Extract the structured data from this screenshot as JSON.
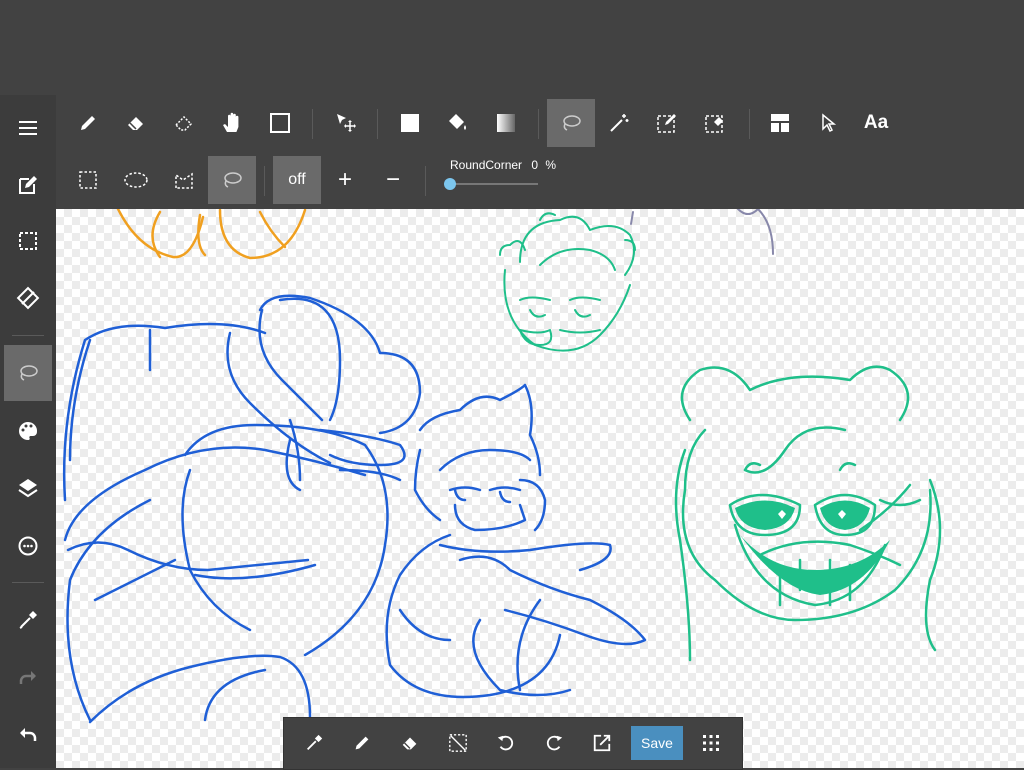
{
  "toolbar": {
    "tools": [
      "pen-icon",
      "eraser-icon",
      "blur-icon",
      "hand-icon",
      "square-icon",
      "move-icon",
      "fill-square-icon",
      "bucket-icon",
      "gradient-icon",
      "lasso-icon",
      "magic-wand-icon",
      "select-pen-icon",
      "select-eraser-icon",
      "layer-icon",
      "pointer-icon",
      "text-icon"
    ],
    "text_tool_label": "Aa"
  },
  "selection_bar": {
    "off_label": "off",
    "plus_label": "+",
    "minus_label": "−",
    "round_corner_label": "RoundCorner",
    "round_corner_value": "0",
    "round_corner_unit": "%",
    "round_corner_level": 0
  },
  "sidebar": {
    "items": [
      "menu-icon",
      "edit-icon",
      "selection-icon",
      "transform-icon",
      "lasso-icon",
      "palette-icon",
      "layers-icon",
      "material-icon",
      "eyedropper-icon",
      "redo-icon",
      "undo-icon"
    ]
  },
  "bottombar": {
    "save_label": "Save"
  },
  "colors": {
    "toolbar_bg": "#424242",
    "active_tool": "#6a6a6a",
    "save_button": "#4a8fbf",
    "sketch_blue": "#1f5fd6",
    "sketch_green": "#1fbf8a",
    "sketch_orange": "#f0a020"
  }
}
